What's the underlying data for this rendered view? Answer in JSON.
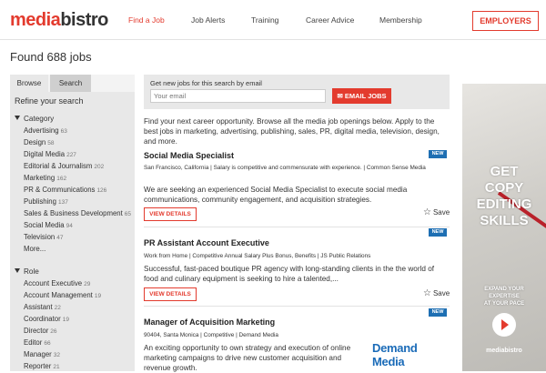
{
  "header": {
    "logo_part1": "media",
    "logo_part2": "bistro",
    "nav": [
      "Find a Job",
      "Job Alerts",
      "Training",
      "Career Advice",
      "Membership"
    ],
    "employers": "EMPLOYERS"
  },
  "found": "Found 688 jobs",
  "sidebar": {
    "tabs": [
      "Browse",
      "Search"
    ],
    "refine": "Refine your search",
    "category_title": "Category",
    "categories": [
      {
        "label": "Advertising",
        "count": "63"
      },
      {
        "label": "Design",
        "count": "58"
      },
      {
        "label": "Digital Media",
        "count": "227"
      },
      {
        "label": "Editorial & Journalism",
        "count": "202"
      },
      {
        "label": "Marketing",
        "count": "162"
      },
      {
        "label": "PR & Communications",
        "count": "126"
      },
      {
        "label": "Publishing",
        "count": "137"
      },
      {
        "label": "Sales & Business Development",
        "count": "65"
      },
      {
        "label": "Social Media",
        "count": "94"
      },
      {
        "label": "Television",
        "count": "47"
      },
      {
        "label": "More...",
        "count": ""
      }
    ],
    "role_title": "Role",
    "roles": [
      {
        "label": "Account Executive",
        "count": "29"
      },
      {
        "label": "Account Management",
        "count": "19"
      },
      {
        "label": "Assistant",
        "count": "22"
      },
      {
        "label": "Coordinator",
        "count": "19"
      },
      {
        "label": "Director",
        "count": "26"
      },
      {
        "label": "Editor",
        "count": "66"
      },
      {
        "label": "Manager",
        "count": "32"
      },
      {
        "label": "Reporter",
        "count": "21"
      }
    ]
  },
  "email_signup": {
    "label": "Get new jobs for this search by email",
    "placeholder": "Your email",
    "button": "EMAIL JOBS"
  },
  "intro": "Find your next career opportunity. Browse all the media job openings below. Apply to the best jobs in marketing, advertising, publishing, sales, PR, digital media, television, design, and more.",
  "jobs": [
    {
      "title": "Social Media Specialist",
      "badge": "NEW",
      "meta": "San Francisco, California  |  Salary is competitive and commensurate with experience.  |  Common Sense Media",
      "desc": "We are seeking an experienced Social Media Specialist to execute social media communications, community engagement, and acquisition strategies.",
      "view": "VIEW DETAILS",
      "save": "Save"
    },
    {
      "title": "PR Assistant Account Executive",
      "badge": "NEW",
      "meta": "Work from Home  |  Competitive Annual Salary Plus Bonus, Benefits  |  JS Public Relations",
      "desc": "Successful, fast-paced boutique PR agency with long-standing clients in the the world of food and culinary equipment is seeking to hire a talented,...",
      "view": "VIEW DETAILS",
      "save": "Save"
    },
    {
      "title": "Manager of Acquisition Marketing",
      "badge": "NEW",
      "meta": "90404, Santa Monica  |  Competitive  |  Demand Media",
      "desc": "An exciting opportunity to own strategy and execution of online marketing campaigns to drive new customer acquisition and revenue growth.",
      "company_logo": "Demand Media"
    }
  ],
  "ad": {
    "headline": [
      "GET",
      "COPY",
      "EDITING",
      "SKILLS"
    ],
    "sub": [
      "EXPAND YOUR",
      "EXPERTISE",
      "AT YOUR PACE"
    ],
    "brand": "mediabistro"
  },
  "colors": {
    "accent": "#e33b2e",
    "badge": "#1e6fb3"
  }
}
